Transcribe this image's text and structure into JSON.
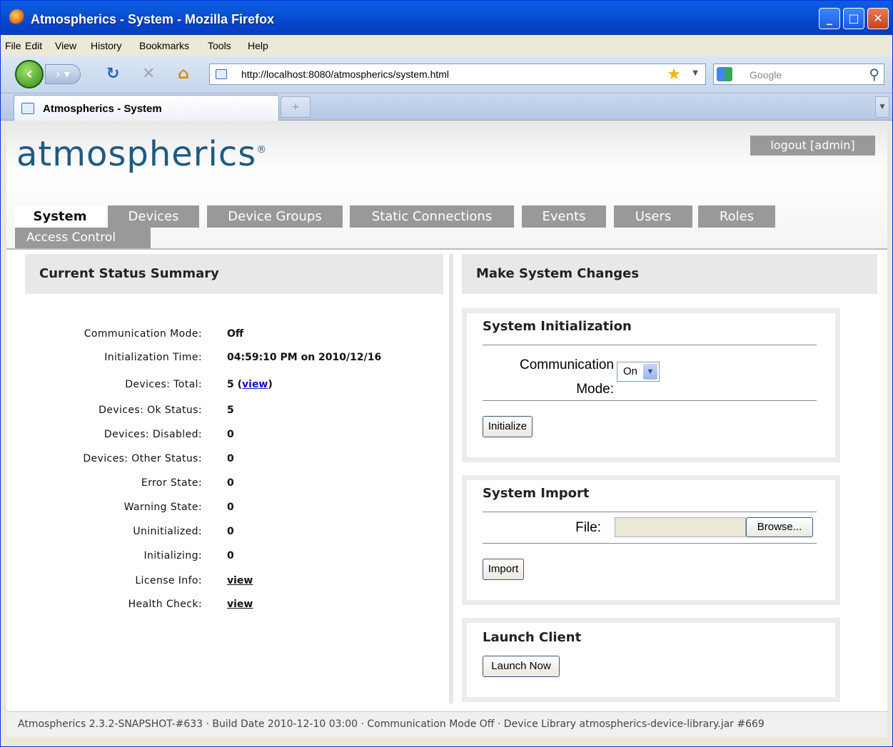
{
  "window": {
    "title": "Atmospherics - System - Mozilla Firefox"
  },
  "menu": [
    "File",
    "Edit",
    "View",
    "History",
    "Bookmarks",
    "Tools",
    "Help"
  ],
  "nav": {
    "url": "http://localhost:8080/atmospherics/system.html",
    "search_placeholder": "Google"
  },
  "tab": {
    "label": "Atmospherics - System",
    "new_tab": "+"
  },
  "header": {
    "logo": "atmospherics",
    "logo_mark": "®",
    "logout": "logout [admin]"
  },
  "navtabs": [
    "System",
    "Devices",
    "Device Groups",
    "Static Connections",
    "Events",
    "Users",
    "Roles",
    "Access Control"
  ],
  "status": {
    "title": "Current Status Summary",
    "rows": [
      {
        "k": "Communication Mode:",
        "v": "Off"
      },
      {
        "k": "Initialization Time:",
        "v": "04:59:10 PM on 2010/12/16"
      },
      {
        "k": "Devices: Total:",
        "v": "5 (",
        "link": "view",
        "after": ")"
      },
      {
        "k": "Devices: Ok Status:",
        "v": "5"
      },
      {
        "k": "Devices: Disabled:",
        "v": "0"
      },
      {
        "k": "Devices: Other Status:",
        "v": "0"
      },
      {
        "k": "Error State:",
        "v": "0"
      },
      {
        "k": "Warning State:",
        "v": "0"
      },
      {
        "k": "Uninitialized:",
        "v": "0"
      },
      {
        "k": "Initializing:",
        "v": "0"
      },
      {
        "k": "License Info:",
        "link": "view"
      },
      {
        "k": "Health Check:",
        "link": "view"
      }
    ]
  },
  "changes": {
    "title": "Make System Changes",
    "init": {
      "title": "System Initialization",
      "label_line1": "Communication",
      "label_line2": "Mode:",
      "select_value": "On",
      "button": "Initialize"
    },
    "import": {
      "title": "System Import",
      "file_label": "File:",
      "browse": "Browse...",
      "button": "Import"
    },
    "launch": {
      "title": "Launch Client",
      "button": "Launch Now"
    }
  },
  "footer": "Atmospherics 2.3.2-SNAPSHOT-#633  ·  Build Date 2010-12-10 03:00  ·  Communication Mode Off  ·  Device Library atmospherics-device-library.jar #669"
}
